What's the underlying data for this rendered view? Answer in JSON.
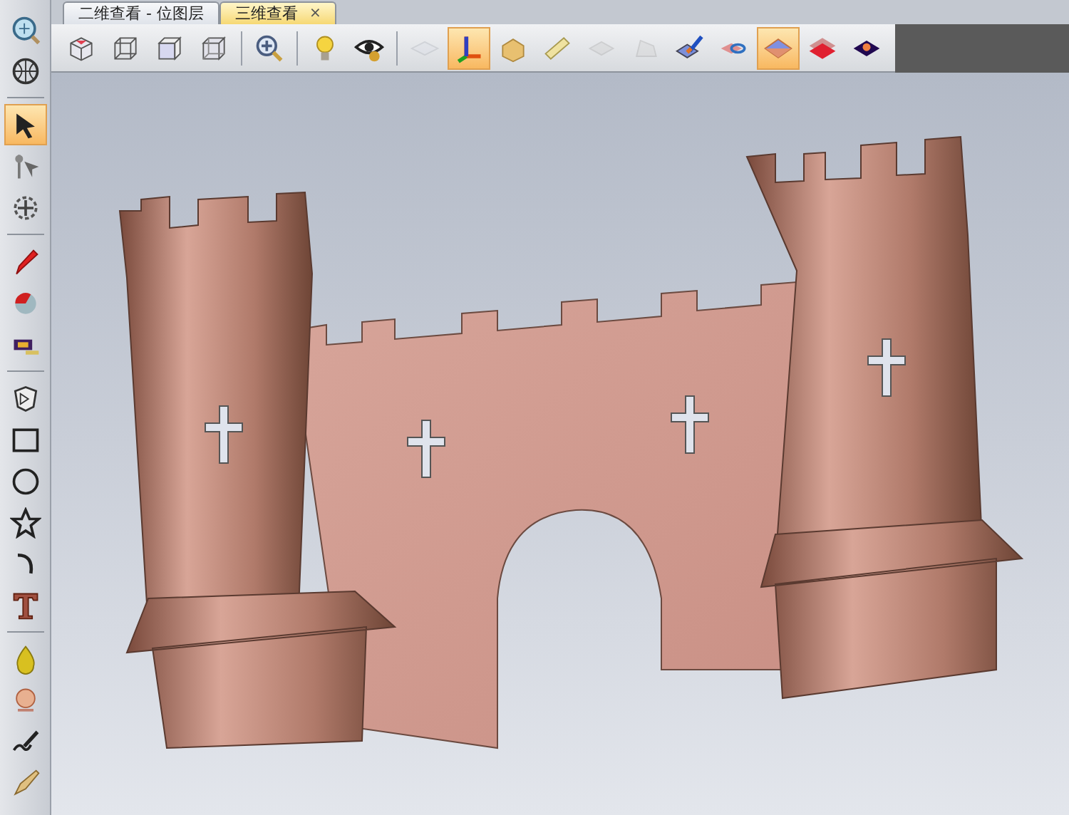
{
  "tabs": [
    {
      "label": "二维查看 - 位图层",
      "selected": false
    },
    {
      "label": "三维查看",
      "selected": true,
      "close": "×"
    }
  ],
  "toolbar": {
    "groups": [
      [
        {
          "selected": false,
          "disabled": false
        },
        {
          "selected": false,
          "disabled": false
        },
        {
          "selected": false,
          "disabled": false
        },
        {
          "selected": false,
          "disabled": false
        }
      ],
      [
        {
          "selected": false,
          "disabled": false
        }
      ],
      [
        {
          "selected": false,
          "disabled": false
        },
        {
          "selected": false,
          "disabled": false
        }
      ],
      [
        {
          "selected": false,
          "disabled": true
        },
        {
          "selected": true,
          "disabled": false
        },
        {
          "selected": false,
          "disabled": false
        },
        {
          "selected": false,
          "disabled": false
        },
        {
          "selected": false,
          "disabled": true
        },
        {
          "selected": false,
          "disabled": true
        },
        {
          "selected": false,
          "disabled": false
        },
        {
          "selected": false,
          "disabled": false
        },
        {
          "selected": true,
          "disabled": false
        },
        {
          "selected": false,
          "disabled": false
        },
        {
          "selected": false,
          "disabled": false
        }
      ]
    ]
  },
  "left_toolbar": {
    "groups": [
      [
        {
          "selected": false
        },
        {
          "selected": false
        }
      ],
      [
        {
          "selected": true
        },
        {
          "selected": false
        },
        {
          "selected": false
        }
      ],
      [
        {
          "selected": false
        },
        {
          "selected": false
        },
        {
          "selected": false
        }
      ],
      [
        {
          "selected": false
        },
        {
          "selected": false
        },
        {
          "selected": false
        },
        {
          "selected": false
        },
        {
          "selected": false
        },
        {
          "selected": false
        }
      ],
      [
        {
          "selected": false
        },
        {
          "selected": false
        },
        {
          "selected": false
        },
        {
          "selected": false
        }
      ]
    ]
  }
}
